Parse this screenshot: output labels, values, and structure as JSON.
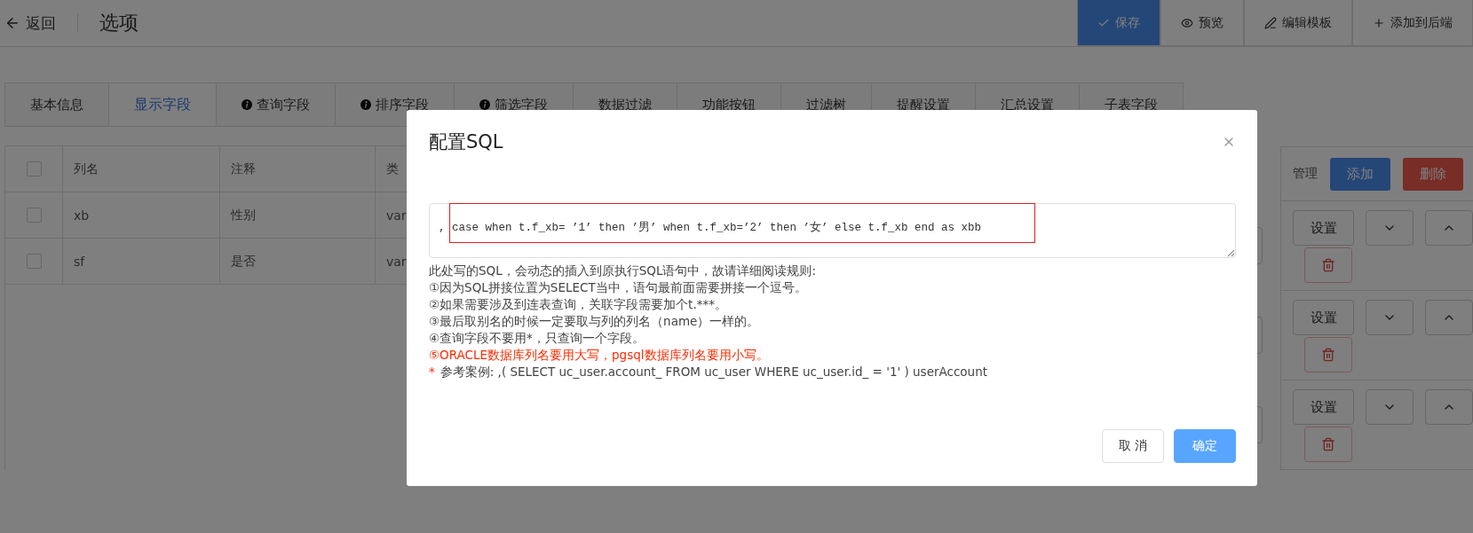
{
  "header": {
    "back": "返回",
    "title": "选项",
    "actions": [
      {
        "label": "保存",
        "primary": true
      },
      {
        "label": "预览",
        "primary": false
      },
      {
        "label": "编辑模板",
        "primary": false
      },
      {
        "label": "添加到后端",
        "primary": false
      }
    ]
  },
  "tabs": [
    {
      "label": "基本信息",
      "selected": false,
      "info": false
    },
    {
      "label": "显示字段",
      "selected": true,
      "info": false
    },
    {
      "label": "查询字段",
      "selected": false,
      "info": true
    },
    {
      "label": "排序字段",
      "selected": false,
      "info": true
    },
    {
      "label": "筛选字段",
      "selected": false,
      "info": true
    },
    {
      "label": "数据过滤",
      "selected": false,
      "info": false
    },
    {
      "label": "功能按钮",
      "selected": false,
      "info": false
    },
    {
      "label": "过滤树",
      "selected": false,
      "info": false
    },
    {
      "label": "提醒设置",
      "selected": false,
      "info": false
    },
    {
      "label": "汇总设置",
      "selected": false,
      "info": false
    },
    {
      "label": "子表字段",
      "selected": false,
      "info": false
    }
  ],
  "table": {
    "header_checked": false,
    "columns": [
      "列名",
      "注释",
      "类"
    ],
    "rows": [
      {
        "checked": false,
        "cells": [
          "xb",
          "性别",
          "var"
        ]
      },
      {
        "checked": false,
        "cells": [
          "sf",
          "是否",
          "var"
        ]
      }
    ]
  },
  "manage": {
    "label": "管理",
    "add": "添加",
    "delete": "删除",
    "rows": [
      {
        "setting": "设置"
      },
      {
        "setting": "设置"
      },
      {
        "setting": "设置"
      }
    ]
  },
  "dialog": {
    "title": "配置SQL",
    "sql_value": ", case when t.f_xb= ’1’ then ’男’ when t.f_xb=’2’ then ’女’ else t.f_xb end as xbb",
    "rules": [
      {
        "kind": "normal",
        "text": "此处写的SQL，会动态的插入到原执行SQL语句中，故请详细阅读规则:"
      },
      {
        "kind": "normal",
        "text": "①因为SQL拼接位置为SELECT当中，语句最前面需要拼接一个逗号。"
      },
      {
        "kind": "normal",
        "text": "②如果需要涉及到连表查询，关联字段需要加个t.***。"
      },
      {
        "kind": "normal",
        "text": "③最后取别名的时候一定要取与列的列名（name）一样的。"
      },
      {
        "kind": "normal",
        "text": "④查询字段不要用*，只查询一个字段。"
      },
      {
        "kind": "warning",
        "text": "⑤ORACLE数据库列名要用大写，pgsql数据库列名要用小写。"
      }
    ],
    "example_mark": "*",
    "example": "参考案例:   ,( SELECT uc_user.account_ FROM uc_user WHERE uc_user.id_ = '1' ) userAccount",
    "buttons": [
      {
        "label": "取 消",
        "primary": false
      },
      {
        "label": "确定",
        "primary": true
      }
    ]
  }
}
